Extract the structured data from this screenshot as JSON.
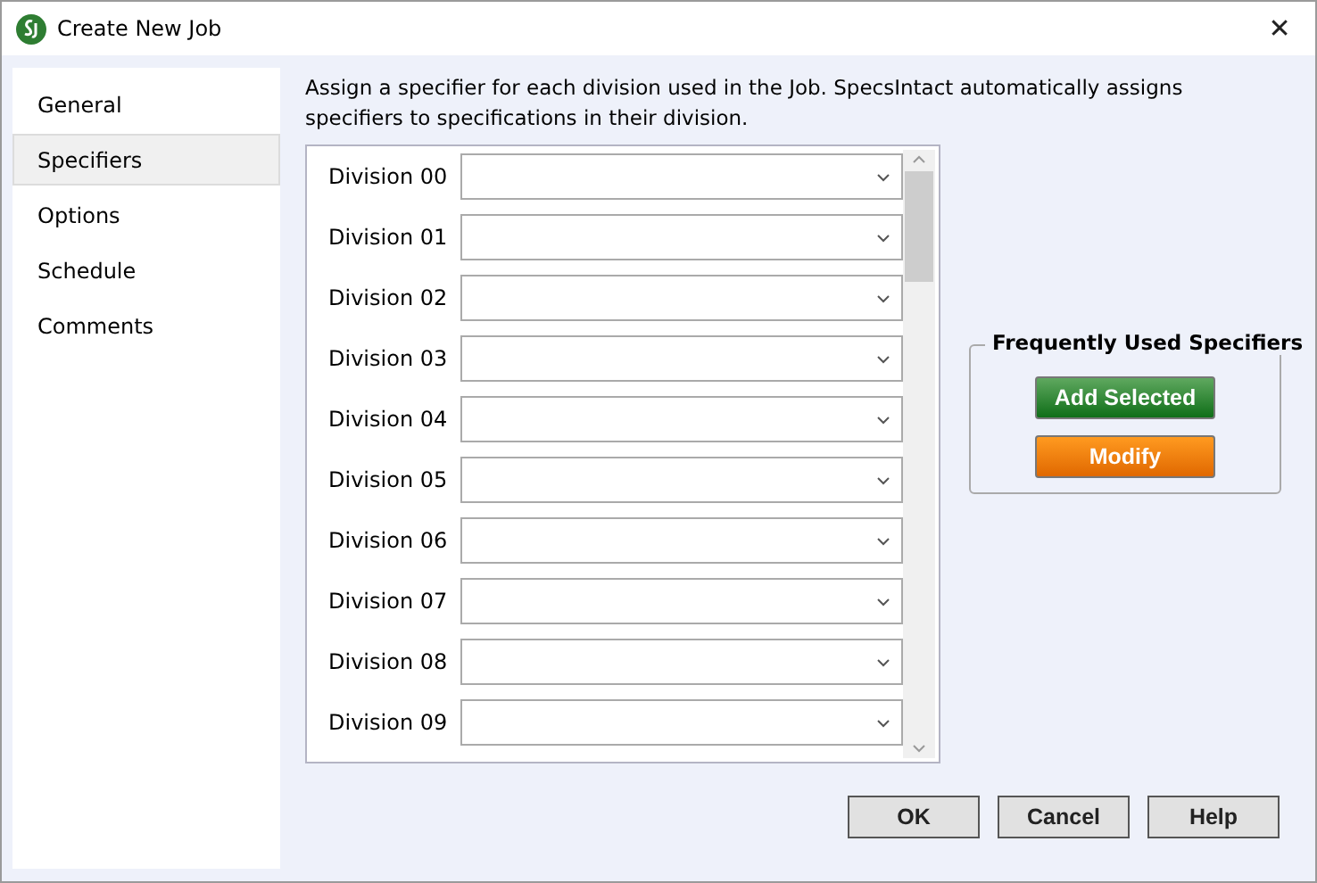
{
  "window": {
    "title": "Create New Job",
    "close": "✕"
  },
  "sidebar": {
    "items": [
      {
        "label": "General",
        "selected": false
      },
      {
        "label": "Specifiers",
        "selected": true
      },
      {
        "label": "Options",
        "selected": false
      },
      {
        "label": "Schedule",
        "selected": false
      },
      {
        "label": "Comments",
        "selected": false
      }
    ]
  },
  "intro": "Assign a specifier for each division used in the Job.  SpecsIntact automatically assigns specifiers to specifications in their division.",
  "divisions": [
    {
      "label": "Division 00"
    },
    {
      "label": "Division 01"
    },
    {
      "label": "Division 02"
    },
    {
      "label": "Division 03"
    },
    {
      "label": "Division 04"
    },
    {
      "label": "Division 05"
    },
    {
      "label": "Division 06"
    },
    {
      "label": "Division 07"
    },
    {
      "label": "Division 08"
    },
    {
      "label": "Division 09"
    }
  ],
  "frequent": {
    "title": "Frequently Used Specifiers",
    "buttons": [
      {
        "label": "Add Selected",
        "kind": "green"
      },
      {
        "label": "Modify",
        "kind": "orange"
      }
    ]
  },
  "buttons": [
    "OK",
    "Cancel",
    "Help"
  ]
}
